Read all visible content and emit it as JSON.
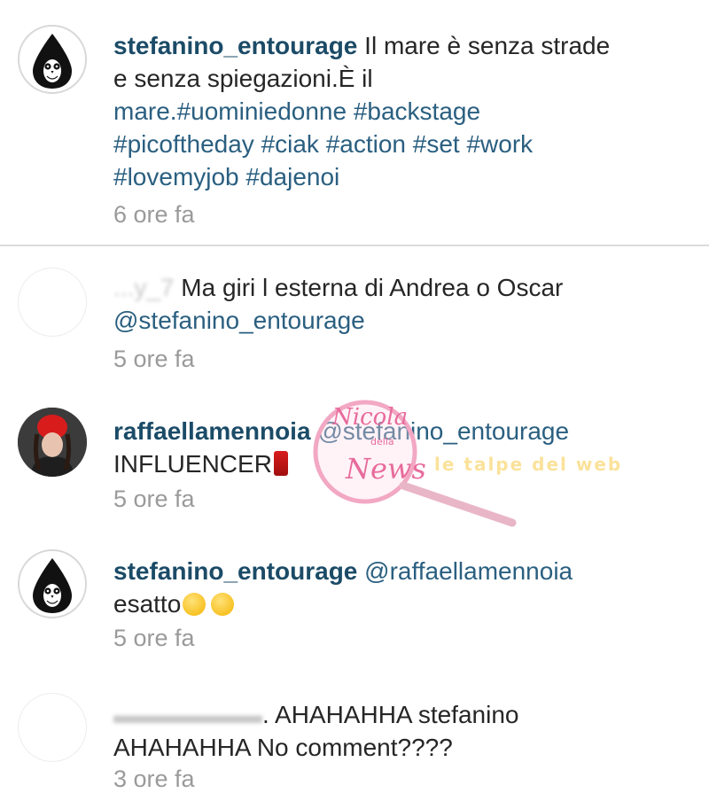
{
  "caption": {
    "username": "stefanino_entourage",
    "lines": [
      "Il mare è senza strade",
      "e senza spiegazioni.È il",
      "mare.#uominiedonne #backstage",
      "#picoftheday #ciak #action  #set #work",
      "#lovemyjob #dajenoi"
    ],
    "time": "6 ore fa"
  },
  "comments": [
    {
      "username_partial": "...y_7",
      "text_line1": "Ma giri l esterna di Andrea o Oscar",
      "text_line2": "@stefanino_entourage",
      "time": "5 ore fa"
    },
    {
      "username": "raffaellamennoia",
      "mention": "@stefanino_entourage",
      "text_line2": "INFLUENCER",
      "time": "5 ore fa"
    },
    {
      "username": "stefanino_entourage",
      "mention": "@raffaellamennoia",
      "text_line2": "esatto",
      "time": "5 ore fa"
    },
    {
      "text_line1": ". AHAHAHHA  stefanino",
      "text_line2": "AHAHAHHA  No comment????",
      "time": "3 ore fa"
    }
  ],
  "watermark": {
    "brand_line1": "Nicola",
    "brand_line2": "della",
    "brand_line3": "News",
    "tagline": "le talpe del web"
  },
  "colors": {
    "username": "#1b4b67",
    "link": "#2a5f80",
    "timestamp": "#9a9a9a",
    "divider": "#dcdcdc"
  },
  "icons": [
    "owl-logo-icon",
    "ribbon-emoji-icon",
    "winking-emoji-icon",
    "laughing-emoji-icon"
  ]
}
